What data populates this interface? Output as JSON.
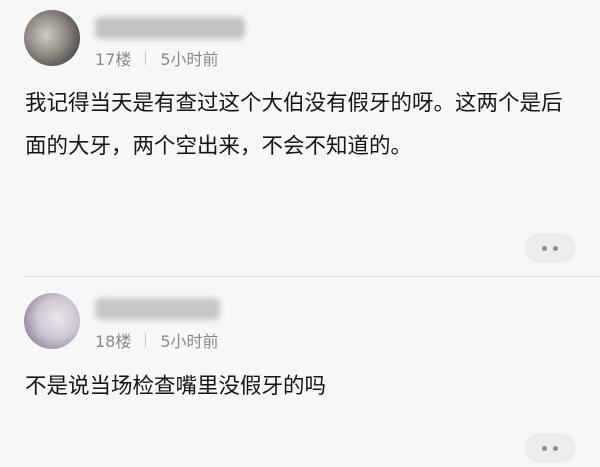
{
  "comments": [
    {
      "floor": "17楼",
      "time": "5小时前",
      "text": "我记得当天是有查过这个大伯没有假牙的呀。这两个是后面的大牙，两个空出来，不会不知道的。",
      "more_icon": "more-dots-icon"
    },
    {
      "floor": "18楼",
      "time": "5小时前",
      "text": "不是说当场检查嘴里没假牙的吗",
      "more_icon": "more-dots-icon"
    }
  ]
}
